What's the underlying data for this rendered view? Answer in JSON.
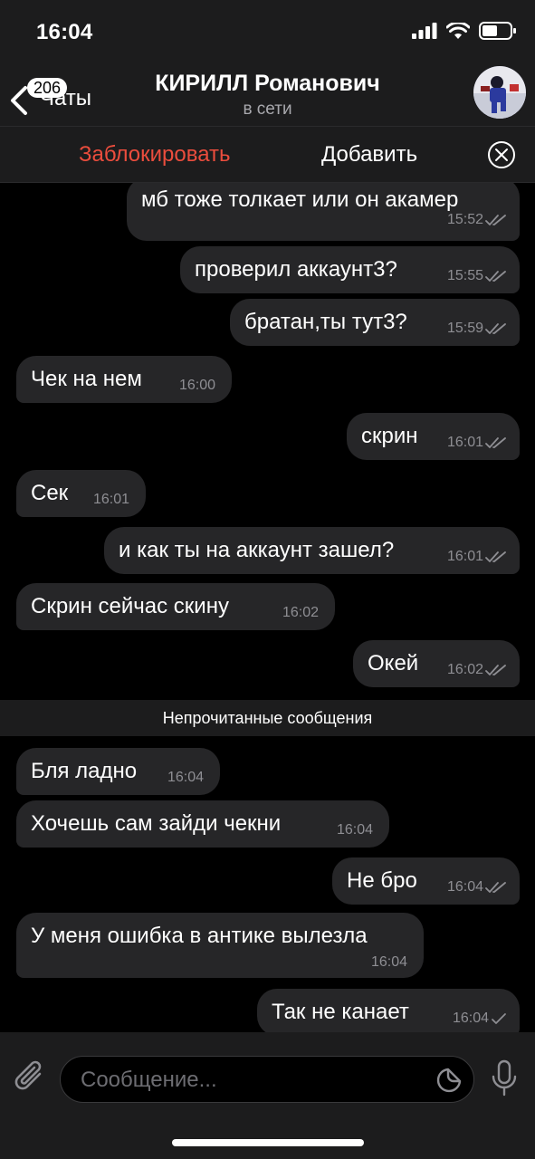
{
  "status": {
    "time": "16:04"
  },
  "header": {
    "back_label": "Чаты",
    "unread_count": "206",
    "title": "КИРИЛЛ Романович",
    "subtitle": "в сети"
  },
  "actions": {
    "block_label": "Заблокировать",
    "add_label": "Добавить"
  },
  "messages": [
    {
      "text": "мб тоже толкает или он акамер",
      "time": "15:52",
      "dir": "out",
      "status": "read"
    },
    {
      "text": "проверил аккаунт3?",
      "time": "15:55",
      "dir": "out",
      "status": "read"
    },
    {
      "text": "братан,ты тут3?",
      "time": "15:59",
      "dir": "out",
      "status": "read"
    },
    {
      "text": "Чек на нем",
      "time": "16:00",
      "dir": "in"
    },
    {
      "text": "скрин",
      "time": "16:01",
      "dir": "out",
      "status": "read"
    },
    {
      "text": "Сек",
      "time": "16:01",
      "dir": "in"
    },
    {
      "text": "и как ты на аккаунт зашел?",
      "time": "16:01",
      "dir": "out",
      "status": "read"
    },
    {
      "text": "Скрин сейчас скину",
      "time": "16:02",
      "dir": "in"
    },
    {
      "text": "Окей",
      "time": "16:02",
      "dir": "out",
      "status": "read"
    },
    {
      "text": "Бля ладно",
      "time": "16:04",
      "dir": "in"
    },
    {
      "text": "Хочешь сам зайди чекни",
      "time": "16:04",
      "dir": "in"
    },
    {
      "text": "Не бро",
      "time": "16:04",
      "dir": "out",
      "status": "read"
    },
    {
      "text": "У меня ошибка в антике вылезла",
      "time": "16:04",
      "dir": "in"
    },
    {
      "text": "Так не канает",
      "time": "16:04",
      "dir": "out",
      "status": "sent"
    }
  ],
  "unread_divider": "Непрочитанные сообщения",
  "input": {
    "placeholder": "Сообщение..."
  },
  "colors": {
    "accent_red": "#eb4d3d",
    "bubble": "#262628",
    "bar": "#1c1c1d"
  },
  "icons": [
    "signal-icon",
    "wifi-icon",
    "battery-icon",
    "back-chevron-icon",
    "close-circle-icon",
    "read-check-icon",
    "sent-check-icon",
    "attach-icon",
    "sticker-icon",
    "mic-icon"
  ]
}
